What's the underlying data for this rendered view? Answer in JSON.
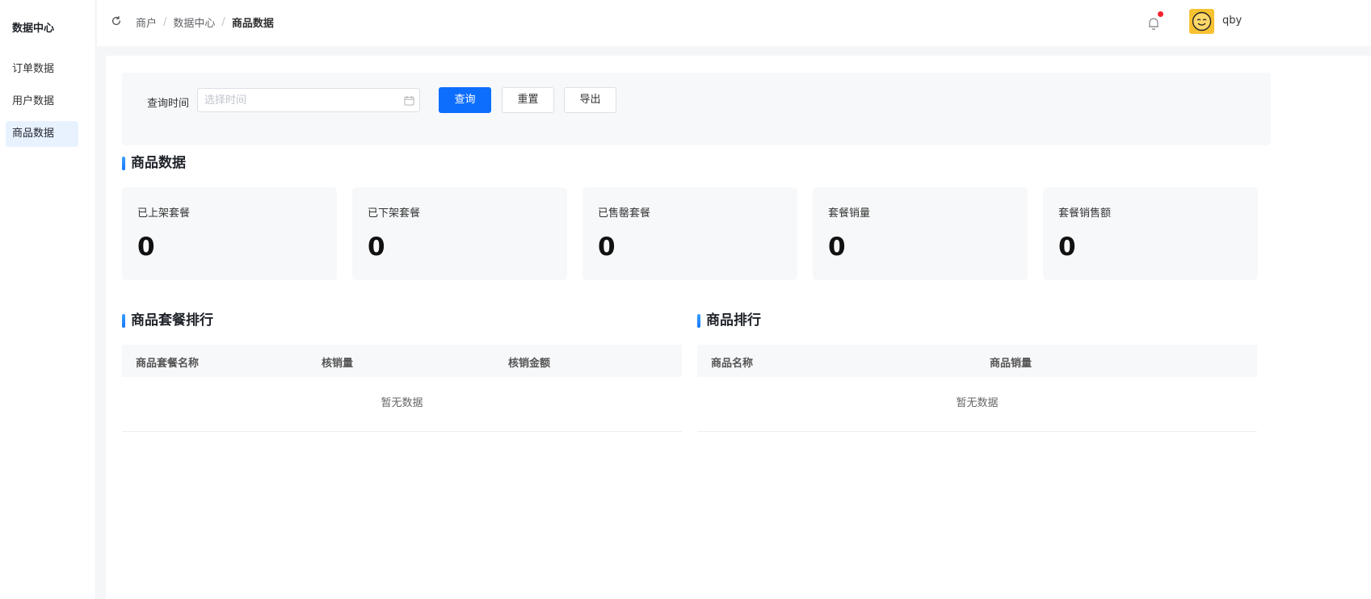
{
  "sidebar": {
    "title": "数据中心",
    "items": [
      {
        "label": "订单数据"
      },
      {
        "label": "用户数据"
      },
      {
        "label": "商品数据"
      }
    ]
  },
  "header": {
    "breadcrumb": [
      "商户",
      "数据中心",
      "商品数据"
    ],
    "username": "qby",
    "notification_dot_color": "#f5222d"
  },
  "filter": {
    "label": "查询时间",
    "date_placeholder": "选择时间",
    "date_value": "",
    "query_label": "查询",
    "reset_label": "重置",
    "export_label": "导出"
  },
  "stats_section": {
    "title": "商品数据",
    "cards": [
      {
        "label": "已上架套餐",
        "value": "0"
      },
      {
        "label": "已下架套餐",
        "value": "0"
      },
      {
        "label": "已售罄套餐",
        "value": "0"
      },
      {
        "label": "套餐销量",
        "value": "0"
      },
      {
        "label": "套餐销售额",
        "value": "0"
      }
    ]
  },
  "package_ranking": {
    "title": "商品套餐排行",
    "columns": [
      "商品套餐名称",
      "核销量",
      "核销金额"
    ],
    "empty_text": "暂无数据"
  },
  "product_ranking": {
    "title": "商品排行",
    "columns": [
      "商品名称",
      "商品销量"
    ],
    "empty_text": "暂无数据"
  },
  "colors": {
    "primary": "#0d6efd",
    "accent_bar": "#1677ff",
    "active_menu_bg": "#e8f2ff"
  }
}
